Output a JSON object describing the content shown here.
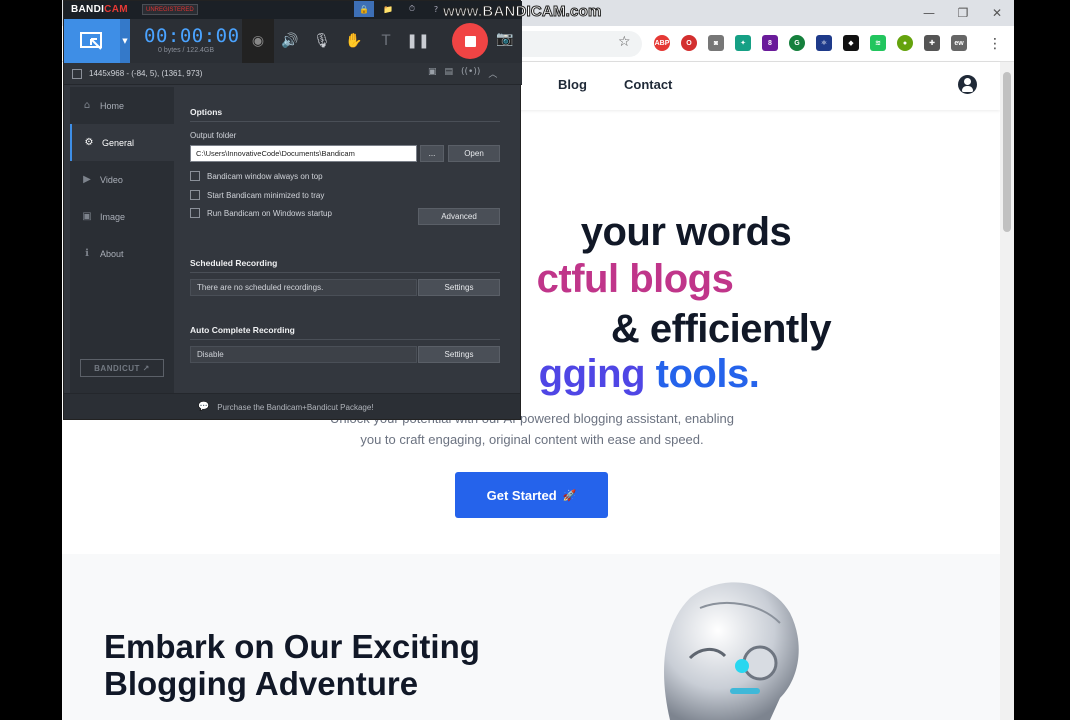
{
  "watermark": "www.BANDICAM.com",
  "browser": {
    "window_controls": {
      "minimize": "—",
      "restore": "❐",
      "close": "✕"
    },
    "star_icon": "☆",
    "menu_icon": "⋮",
    "extensions": [
      {
        "name": "abp-icon",
        "label": "ABP",
        "color": "#e53935",
        "round": true
      },
      {
        "name": "opera-icon",
        "label": "O",
        "color": "#d32f2f",
        "round": true
      },
      {
        "name": "camera-ext-icon",
        "label": "◙",
        "color": "#777777",
        "round": false
      },
      {
        "name": "leaf-ext-icon",
        "label": "✦",
        "color": "#16a085",
        "round": false
      },
      {
        "name": "puzzle-badge-icon",
        "label": "8",
        "color": "#6a1b9a",
        "round": false
      },
      {
        "name": "grammarly-icon",
        "label": "G",
        "color": "#15803d",
        "round": true
      },
      {
        "name": "react-ext-icon",
        "label": "⚛",
        "color": "#1e3a8a",
        "round": false
      },
      {
        "name": "dark-ext-icon",
        "label": "◆",
        "color": "#111111",
        "round": false
      },
      {
        "name": "wave-ext-icon",
        "label": "≋",
        "color": "#22c55e",
        "round": false
      },
      {
        "name": "color-ext-icon",
        "label": "●",
        "color": "#65a30d",
        "round": true
      },
      {
        "name": "extensions-icon",
        "label": "✚",
        "color": "#555555",
        "round": false
      },
      {
        "name": "profile-ext-icon",
        "label": "ew",
        "color": "#666666",
        "round": false
      }
    ]
  },
  "site": {
    "nav": {
      "blog": "Blog",
      "contact": "Contact"
    },
    "hero": {
      "line1": "your words",
      "line2": "ctful blogs",
      "line3": "& efficiently",
      "line4a": "gging",
      "line4b": "tools.",
      "subtitle_line1": "Unlock your potential with our AI-powered blogging assistant, enabling",
      "subtitle_line2": "you to craft engaging, original content with ease and speed."
    },
    "cta": {
      "label": "Get Started",
      "icon": "🚀"
    },
    "section_title_line1": "Embark on Our Exciting",
    "section_title_line2": "Blogging Adventure",
    "colors": {
      "dark": "#111827",
      "pink": "#c0358a",
      "blue": "#2563eb"
    }
  },
  "bandicam": {
    "logo_bandi": "BANDI",
    "logo_cam": "CAM",
    "unregistered": "UNREGISTERED",
    "top_icons": {
      "lock": "🔒",
      "folder": "📁",
      "clock": "⏱",
      "help": "?"
    },
    "timer": "00:00:00",
    "size": "0 bytes / 122.4GB",
    "tools": {
      "webcam": "◉",
      "speaker": "🔊",
      "mic": "🎙",
      "cursor": "✋",
      "text": "T",
      "pause": "❚❚",
      "screenshot": "📷"
    },
    "region_text": "1445x968 - (-84, 5), (1361, 973)",
    "region_icons": {
      "camcorder": "▣",
      "image": "▤",
      "broadcast": "((•))",
      "collapse": "︿"
    },
    "nav": [
      {
        "label": "Home",
        "icon": "⌂"
      },
      {
        "label": "General",
        "icon": "⚙"
      },
      {
        "label": "Video",
        "icon": "▶"
      },
      {
        "label": "Image",
        "icon": "▣"
      },
      {
        "label": "About",
        "icon": "ℹ"
      }
    ],
    "bandicut": "BANDICUT ↗",
    "options": {
      "title": "Options",
      "output_folder_label": "Output folder",
      "output_folder_value": "C:\\Users\\InnovativeCode\\Documents\\Bandicam",
      "browse": "...",
      "open": "Open",
      "check_always_top": "Bandicam window always on top",
      "check_minimized": "Start Bandicam minimized to tray",
      "check_startup": "Run Bandicam on Windows startup",
      "advanced": "Advanced"
    },
    "scheduled": {
      "title": "Scheduled Recording",
      "value": "There are no scheduled recordings.",
      "settings": "Settings"
    },
    "auto_complete": {
      "title": "Auto Complete Recording",
      "value": "Disable",
      "settings": "Settings"
    },
    "promo": {
      "icon": "💬",
      "text": "Purchase the Bandicam+Bandicut Package!"
    }
  }
}
